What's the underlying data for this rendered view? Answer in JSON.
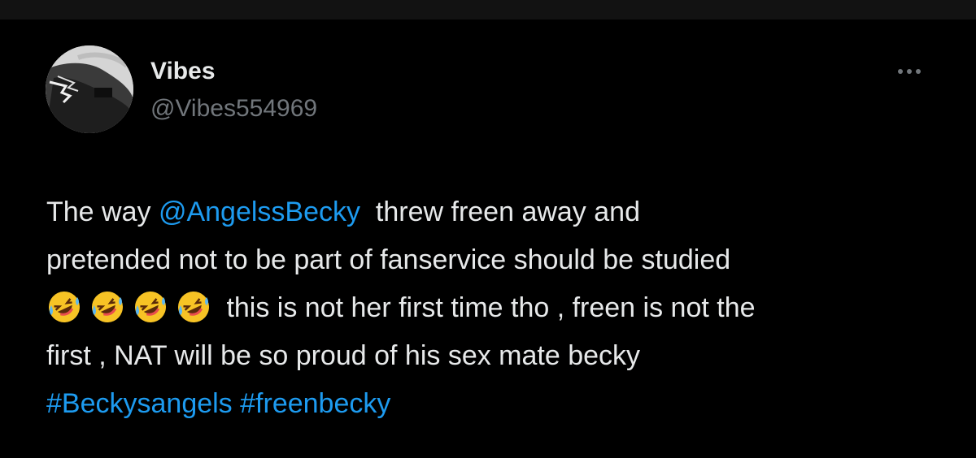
{
  "tweet": {
    "author": {
      "display_name": "Vibes",
      "handle": "@Vibes554969",
      "avatar_icon": "profile-photo"
    },
    "more_icon": "more-horizontal-icon",
    "body": {
      "line1_prefix": "The way ",
      "mention": "@AngelssBecky",
      "line1_suffix": "  threw freen away and",
      "line2": "pretended not to be part of fanservice should be studied",
      "emojis": [
        "rolling-on-floor-laughing-emoji",
        "rolling-on-floor-laughing-emoji",
        "rolling-on-floor-laughing-emoji",
        "rolling-on-floor-laughing-emoji"
      ],
      "line3_text": " this is not her first time tho , freen is not the",
      "line4": "first , NAT will be so proud of his sex mate becky",
      "hashtags": [
        "#Beckysangels",
        "#freenbecky"
      ]
    }
  },
  "colors": {
    "background": "#000000",
    "text_primary": "#e7e9ea",
    "text_secondary": "#71767b",
    "link": "#1d9bf0"
  }
}
